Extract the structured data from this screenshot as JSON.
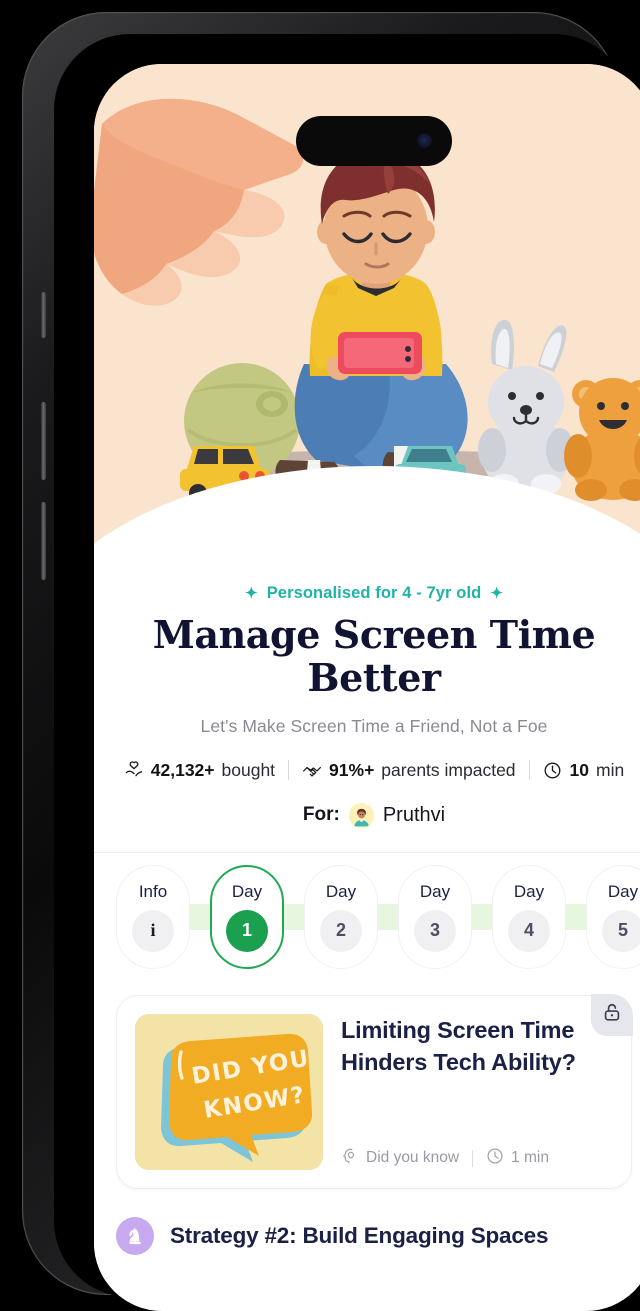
{
  "hero": {
    "background_color": "#fbe4cd",
    "illustration_name": "child-on-phone-with-toys-and-reaching-hand",
    "alt": "Illustration of a child sitting cross-legged playing on a phone with toys around and an adult hand reaching toward the phone"
  },
  "header": {
    "personalised_badge": "Personalised for 4 - 7yr old",
    "spark_left": "✦",
    "spark_right": "✦",
    "badge_color": "#1fb3a6",
    "title": "Manage Screen Time Better",
    "subtitle": "Let's Make Screen Time a Friend, Not a Foe"
  },
  "stats": [
    {
      "icon": "heart-in-hand-icon",
      "value": "42,132+",
      "label": "bought"
    },
    {
      "icon": "handshake-icon",
      "value": "91%+",
      "label": "parents impacted"
    },
    {
      "icon": "clock-icon",
      "value": "10",
      "label": "min"
    }
  ],
  "for_row": {
    "label": "For:",
    "avatar_icon": "boy-avatar",
    "name": "Pruthvi"
  },
  "stepper": {
    "items": [
      {
        "word": "Info",
        "badge": "i",
        "state": "info"
      },
      {
        "word": "Day",
        "badge": "1",
        "state": "active"
      },
      {
        "word": "Day",
        "badge": "2",
        "state": "locked"
      },
      {
        "word": "Day",
        "badge": "3",
        "state": "locked"
      },
      {
        "word": "Day",
        "badge": "4",
        "state": "locked"
      },
      {
        "word": "Day",
        "badge": "5",
        "state": "locked"
      }
    ],
    "active_color": "#1aa04e",
    "connector_color": "#e7f6de"
  },
  "lesson_card": {
    "thumbnail_icon": "did-you-know-speech-bubble",
    "thumbnail_text_line1": "DID YOU",
    "thumbnail_text_line2": "KNOW?",
    "title": "Limiting Screen Time Hinders Tech Ability?",
    "meta": [
      {
        "icon": "head-idea-icon",
        "text": "Did you know"
      },
      {
        "icon": "clock-icon",
        "text": "1 min"
      }
    ],
    "lock_icon": "unlock-icon"
  },
  "strategy": {
    "icon": "chess-knight-icon",
    "label": "Strategy #2: Build Engaging Spaces",
    "icon_bg": "#c7a9ef"
  }
}
